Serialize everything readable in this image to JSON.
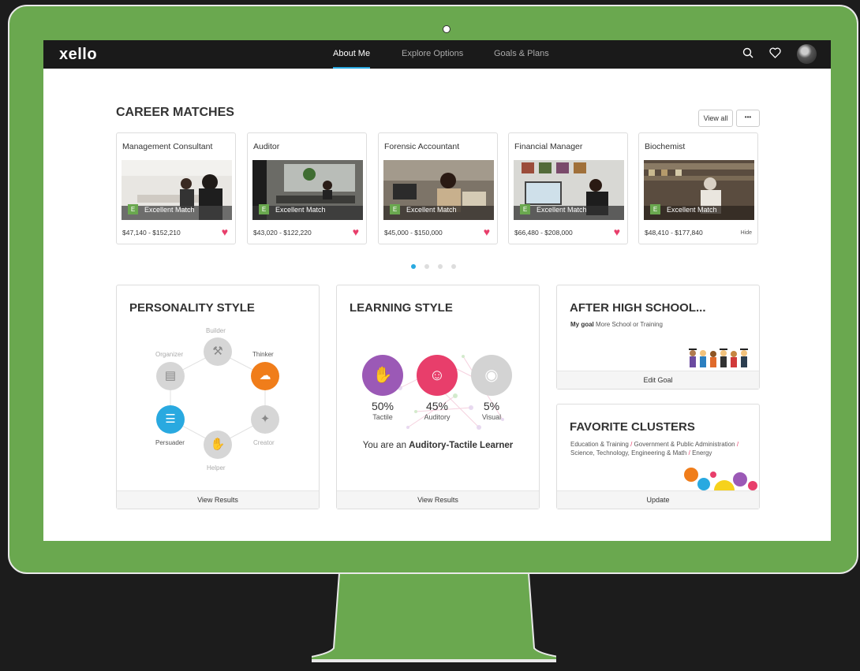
{
  "app": {
    "logo": "xello"
  },
  "nav": {
    "items": [
      "About Me",
      "Explore Options",
      "Goals & Plans"
    ],
    "active": "About Me"
  },
  "topbar_icons": [
    "search-icon",
    "heart-icon",
    "avatar"
  ],
  "career_matches": {
    "title": "CAREER MATCHES",
    "view_all": "View all",
    "more": "•••",
    "cards": [
      {
        "title": "Management Consultant",
        "badge_letter": "E",
        "badge": "Excellent Match",
        "salary": "$47,140 - $152,210",
        "favorite": true
      },
      {
        "title": "Auditor",
        "badge_letter": "E",
        "badge": "Excellent Match",
        "salary": "$43,020 - $122,220",
        "favorite": true
      },
      {
        "title": "Forensic Accountant",
        "badge_letter": "E",
        "badge": "Excellent Match",
        "salary": "$45,000 - $150,000",
        "favorite": true
      },
      {
        "title": "Financial Manager",
        "badge_letter": "E",
        "badge": "Excellent Match",
        "salary": "$66,480 - $208,000",
        "favorite": true
      },
      {
        "title": "Biochemist",
        "badge_letter": "E",
        "badge": "Excellent Match",
        "salary": "$48,410 - $177,840",
        "hide": "Hide"
      }
    ],
    "page_count": 4,
    "active_page": 1
  },
  "personality": {
    "title": "PERSONALITY STYLE",
    "nodes": [
      "Builder",
      "Thinker",
      "Creator",
      "Helper",
      "Persuader",
      "Organizer"
    ],
    "highlighted": [
      "Thinker",
      "Persuader"
    ],
    "footer": "View Results"
  },
  "learning": {
    "title": "LEARNING STYLE",
    "styles": [
      {
        "pct": "50%",
        "name": "Tactile",
        "color": "#9b59b6"
      },
      {
        "pct": "45%",
        "name": "Auditory",
        "color": "#e83e6b"
      },
      {
        "pct": "5%",
        "name": "Visual",
        "color": "#d3d3d3"
      }
    ],
    "summary_prefix": "You are an",
    "summary_bold": "Auditory-Tactile Learner",
    "footer": "View Results"
  },
  "after_high_school": {
    "title": "AFTER HIGH SCHOOL...",
    "goal_label": "My goal",
    "goal_value": "More School or Training",
    "footer": "Edit Goal"
  },
  "favorite_clusters": {
    "title": "FAVORITE CLUSTERS",
    "clusters": [
      "Education & Training",
      "Government & Public Administration",
      "Science, Technology, Engineering & Math",
      "Energy"
    ],
    "separator": "/",
    "footer": "Update"
  },
  "colors": {
    "accent": "#29a9e0",
    "bezel": "#6aa84f",
    "heart": "#e83e6b",
    "thinker": "#f07d1a",
    "persuader": "#29a9e0"
  }
}
